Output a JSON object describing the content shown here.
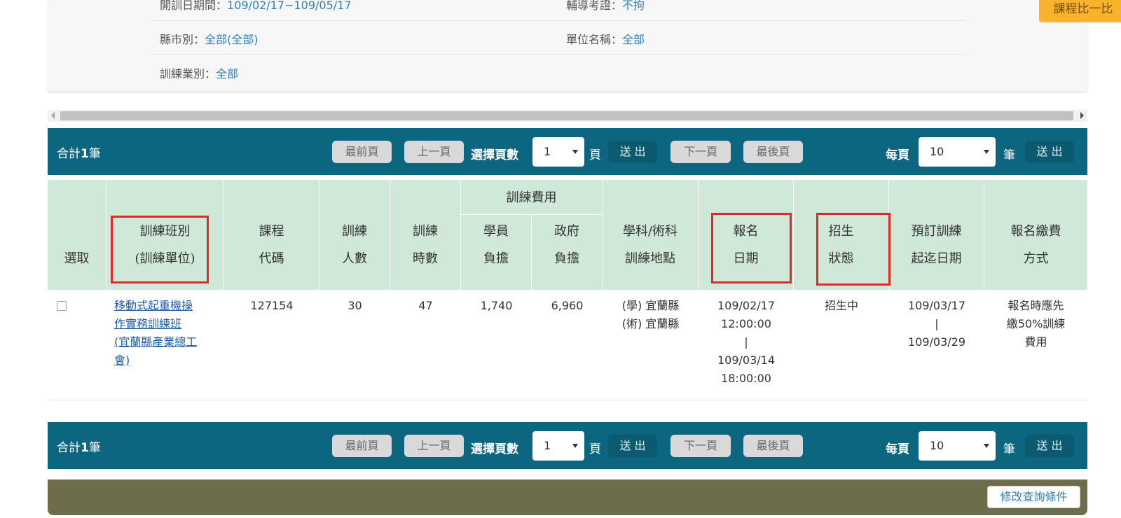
{
  "criteria": {
    "open_date_label": "開訓日期間：",
    "open_date_value": "109/02/17~109/05/17",
    "county_label": "縣市別：",
    "county_value": "全部(全部)",
    "industry_label": "訓練業別：",
    "industry_value": "全部",
    "cert_label": "輔導考證：",
    "cert_value": "不拘",
    "unit_label": "單位名稱：",
    "unit_value": "全部",
    "compare_button": "課程比一比"
  },
  "pager": {
    "total_prefix": "合計",
    "total_count": "1",
    "total_suffix": "筆",
    "first": "最前頁",
    "prev": "上一頁",
    "select_label": "選擇頁數",
    "page_value": "1",
    "page_unit": "頁",
    "submit": "送 出",
    "next": "下一頁",
    "last": "最後頁",
    "per_page_label": "每頁",
    "per_page_value": "10",
    "per_page_unit": "筆",
    "per_page_submit": "送 出"
  },
  "table": {
    "headers": {
      "select": "選取",
      "class_1": "訓練班別",
      "class_2": "(訓練單位)",
      "code_1": "課程",
      "code_2": "代碼",
      "people_1": "訓練",
      "people_2": "人數",
      "hours_1": "訓練",
      "hours_2": "時數",
      "fee_group": "訓練費用",
      "student_1": "學員",
      "student_2": "負擔",
      "gov_1": "政府",
      "gov_2": "負擔",
      "place_1": "學科/術科",
      "place_2": "訓練地點",
      "reg_1": "報名",
      "reg_2": "日期",
      "status_1": "招生",
      "status_2": "狀態",
      "schedule_1": "預訂訓練",
      "schedule_2": "起迄日期",
      "pay_1": "報名繳費",
      "pay_2": "方式"
    },
    "row": {
      "class_line1": "移動式起重機操",
      "class_line2": "作實務訓練班",
      "class_line3": "(宜蘭縣產業總工",
      "class_line4": "會)",
      "code": "127154",
      "people": "30",
      "hours": "47",
      "student_fee": "1,740",
      "gov_fee": "6,960",
      "place_1": "(學) 宜蘭縣",
      "place_2": "(術) 宜蘭縣",
      "reg_1": "109/02/17",
      "reg_2": "12:00:00",
      "reg_sep": "|",
      "reg_3": "109/03/14",
      "reg_4": "18:00:00",
      "status": "招生中",
      "sch_1": "109/03/17",
      "sch_sep": "|",
      "sch_2": "109/03/29",
      "pay_1": "報名時應先",
      "pay_2": "繳50%訓練",
      "pay_3": "費用"
    }
  },
  "footer": {
    "modify_button": "修改查詢條件"
  }
}
